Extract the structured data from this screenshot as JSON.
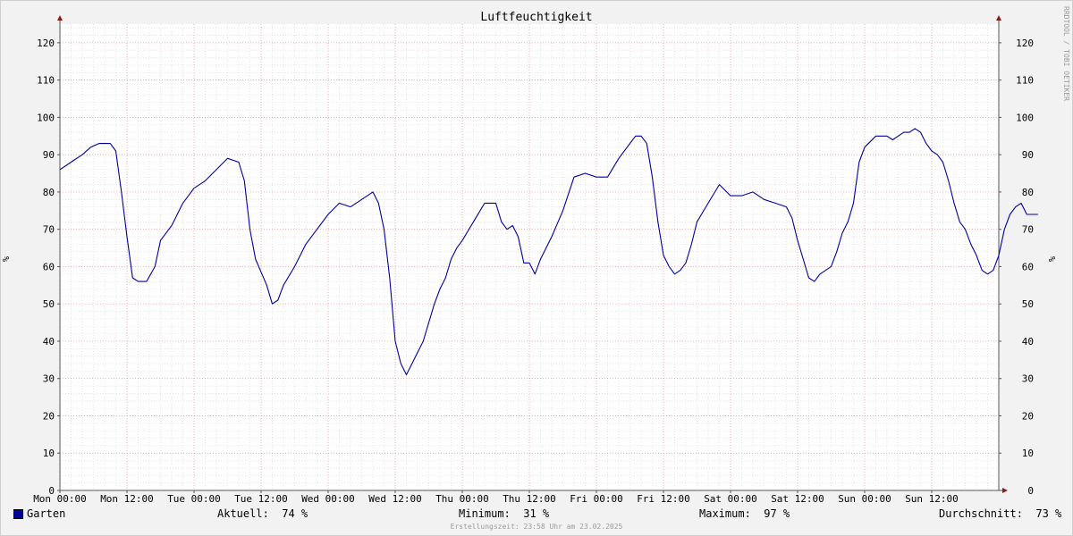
{
  "chart_data": {
    "type": "line",
    "title": "Luftfeuchtigkeit",
    "ylabel": "%",
    "ylim": [
      0,
      125
    ],
    "yticks": [
      0,
      10,
      20,
      30,
      40,
      50,
      60,
      70,
      80,
      90,
      100,
      110,
      120
    ],
    "xlim": [
      0,
      168
    ],
    "xticks": [
      {
        "x": 0,
        "label": "Mon 00:00"
      },
      {
        "x": 12,
        "label": "Mon 12:00"
      },
      {
        "x": 24,
        "label": "Tue 00:00"
      },
      {
        "x": 36,
        "label": "Tue 12:00"
      },
      {
        "x": 48,
        "label": "Wed 00:00"
      },
      {
        "x": 60,
        "label": "Wed 12:00"
      },
      {
        "x": 72,
        "label": "Thu 00:00"
      },
      {
        "x": 84,
        "label": "Thu 12:00"
      },
      {
        "x": 96,
        "label": "Fri 00:00"
      },
      {
        "x": 108,
        "label": "Fri 12:00"
      },
      {
        "x": 120,
        "label": "Sat 00:00"
      },
      {
        "x": 132,
        "label": "Sat 12:00"
      },
      {
        "x": 144,
        "label": "Sun 00:00"
      },
      {
        "x": 156,
        "label": "Sun 12:00"
      }
    ],
    "grid": true,
    "series": [
      {
        "name": "Garten",
        "color": "#00009c",
        "points": [
          [
            0,
            86
          ],
          [
            2,
            88
          ],
          [
            4,
            90
          ],
          [
            5.5,
            92
          ],
          [
            7,
            93
          ],
          [
            9,
            93
          ],
          [
            10,
            91
          ],
          [
            11,
            80
          ],
          [
            12,
            68
          ],
          [
            13,
            57
          ],
          [
            14,
            56
          ],
          [
            15.5,
            56
          ],
          [
            17,
            60
          ],
          [
            18,
            67
          ],
          [
            20,
            71
          ],
          [
            22,
            77
          ],
          [
            24,
            81
          ],
          [
            26,
            83
          ],
          [
            28,
            86
          ],
          [
            30,
            89
          ],
          [
            32,
            88
          ],
          [
            33,
            83
          ],
          [
            34,
            70
          ],
          [
            35,
            62
          ],
          [
            37,
            55
          ],
          [
            38,
            50
          ],
          [
            39,
            51
          ],
          [
            40,
            55
          ],
          [
            42,
            60
          ],
          [
            44,
            66
          ],
          [
            46,
            70
          ],
          [
            48,
            74
          ],
          [
            50,
            77
          ],
          [
            52,
            76
          ],
          [
            54,
            78
          ],
          [
            56,
            80
          ],
          [
            57,
            77
          ],
          [
            58,
            70
          ],
          [
            59,
            57
          ],
          [
            60,
            40
          ],
          [
            61,
            34
          ],
          [
            62,
            31
          ],
          [
            63,
            34
          ],
          [
            64,
            37
          ],
          [
            65,
            40
          ],
          [
            66,
            45
          ],
          [
            67,
            50
          ],
          [
            68,
            54
          ],
          [
            69,
            57
          ],
          [
            70,
            62
          ],
          [
            71,
            65
          ],
          [
            72,
            67
          ],
          [
            74,
            72
          ],
          [
            76,
            77
          ],
          [
            78,
            77
          ],
          [
            79,
            72
          ],
          [
            80,
            70
          ],
          [
            81,
            71
          ],
          [
            82,
            68
          ],
          [
            83,
            61
          ],
          [
            84,
            61
          ],
          [
            85,
            58
          ],
          [
            86,
            62
          ],
          [
            88,
            68
          ],
          [
            90,
            75
          ],
          [
            92,
            84
          ],
          [
            94,
            85
          ],
          [
            96,
            84
          ],
          [
            98,
            84
          ],
          [
            100,
            89
          ],
          [
            102,
            93
          ],
          [
            103,
            95
          ],
          [
            104,
            95
          ],
          [
            105,
            93
          ],
          [
            106,
            84
          ],
          [
            107,
            72
          ],
          [
            108,
            63
          ],
          [
            109,
            60
          ],
          [
            110,
            58
          ],
          [
            111,
            59
          ],
          [
            112,
            61
          ],
          [
            113,
            66
          ],
          [
            114,
            72
          ],
          [
            116,
            77
          ],
          [
            118,
            82
          ],
          [
            120,
            79
          ],
          [
            122,
            79
          ],
          [
            124,
            80
          ],
          [
            126,
            78
          ],
          [
            128,
            77
          ],
          [
            130,
            76
          ],
          [
            131,
            73
          ],
          [
            132,
            67
          ],
          [
            133,
            62
          ],
          [
            134,
            57
          ],
          [
            135,
            56
          ],
          [
            136,
            58
          ],
          [
            138,
            60
          ],
          [
            139,
            64
          ],
          [
            140,
            69
          ],
          [
            141,
            72
          ],
          [
            142,
            77
          ],
          [
            143,
            88
          ],
          [
            144,
            92
          ],
          [
            146,
            95
          ],
          [
            148,
            95
          ],
          [
            149,
            94
          ],
          [
            150,
            95
          ],
          [
            151,
            96
          ],
          [
            152,
            96
          ],
          [
            153,
            97
          ],
          [
            154,
            96
          ],
          [
            155,
            93
          ],
          [
            156,
            91
          ],
          [
            157,
            90
          ],
          [
            158,
            88
          ],
          [
            159,
            83
          ],
          [
            160,
            77
          ],
          [
            161,
            72
          ],
          [
            162,
            70
          ],
          [
            163,
            66
          ],
          [
            164,
            63
          ],
          [
            165,
            59
          ],
          [
            166,
            58
          ],
          [
            167,
            59
          ],
          [
            168,
            63
          ],
          [
            169,
            70
          ],
          [
            170,
            74
          ],
          [
            171,
            76
          ],
          [
            172,
            77
          ],
          [
            173,
            74
          ],
          [
            175,
            74
          ]
        ]
      }
    ]
  },
  "legend": {
    "series_name": "Garten",
    "current": "Aktuell:  74 %",
    "minimum": "Minimum:  31 %",
    "maximum": "Maximum:  97 %",
    "average": "Durchschnitt:  73 %"
  },
  "footer": "Erstellungszeit: 23:58 Uhr am 23.02.2025",
  "watermark": "RRDTOOL / TOBI OETIKER"
}
